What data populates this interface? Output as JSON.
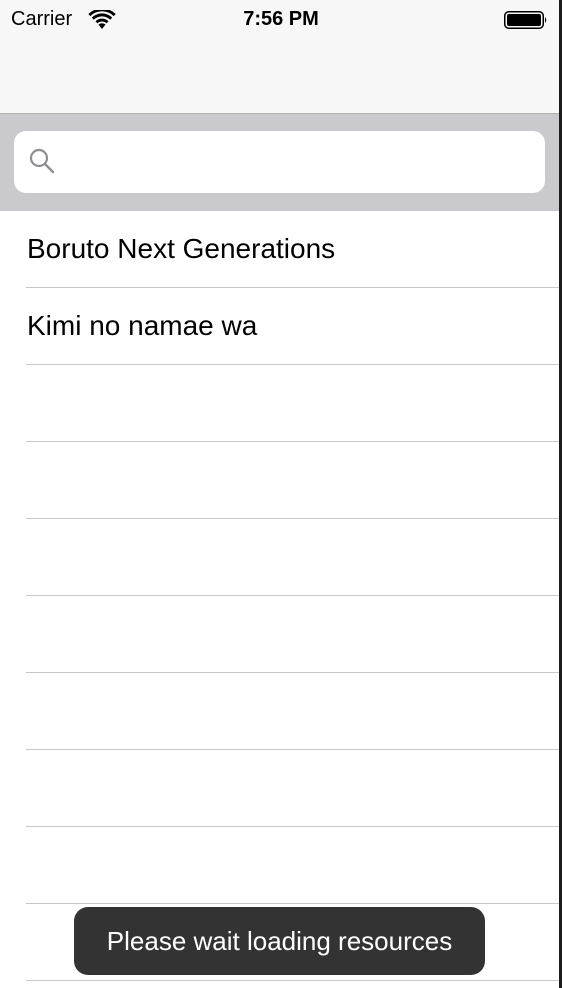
{
  "status_bar": {
    "carrier": "Carrier",
    "time": "7:56 PM",
    "wifi_icon": "wifi-icon",
    "battery_icon": "battery-icon"
  },
  "nav_bar": {
    "title": ""
  },
  "search": {
    "placeholder": "",
    "value": "",
    "icon": "search-icon"
  },
  "list": {
    "items": [
      {
        "label": "Boruto Next Generations"
      },
      {
        "label": "Kimi no namae wa"
      },
      {
        "label": ""
      },
      {
        "label": ""
      },
      {
        "label": ""
      },
      {
        "label": ""
      },
      {
        "label": ""
      },
      {
        "label": ""
      },
      {
        "label": ""
      },
      {
        "label": ""
      }
    ]
  },
  "toast": {
    "message": "Please wait loading resources"
  },
  "colors": {
    "bar_background": "#f7f7f7",
    "search_background": "#c9c9ce",
    "separator": "#c8c7cc",
    "toast_background": "#333333"
  }
}
